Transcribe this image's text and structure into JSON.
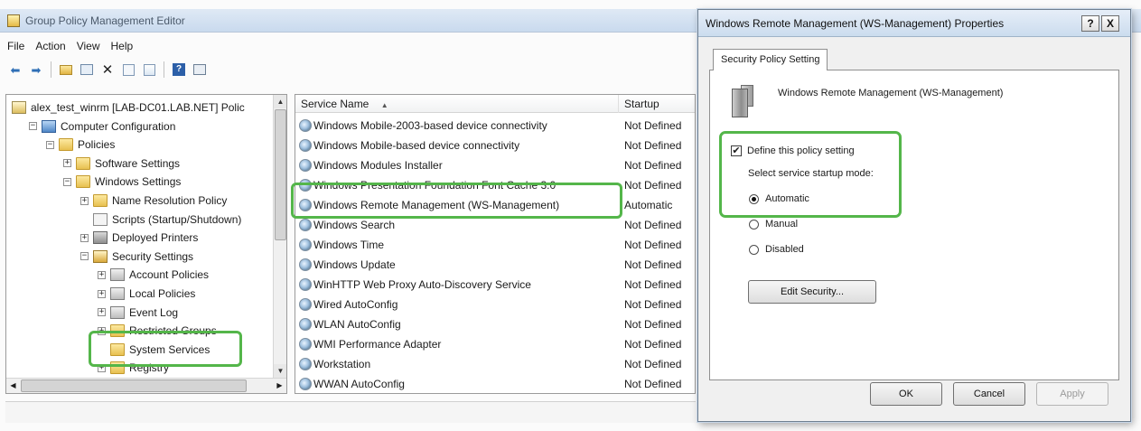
{
  "main_window": {
    "title": "Group Policy Management Editor",
    "menu": [
      "File",
      "Action",
      "View",
      "Help"
    ],
    "toolbar_icons": [
      "back-arrow-icon",
      "forward-arrow-icon",
      "up-folder-icon",
      "show-hide-tree-icon",
      "delete-icon",
      "properties-icon",
      "export-icon",
      "help-icon",
      "console-icon"
    ]
  },
  "tree": {
    "items": [
      {
        "label": "alex_test_winrm [LAB-DC01.LAB.NET] Polic",
        "icon": "gpo-icon",
        "indent": 0,
        "expander": ""
      },
      {
        "label": "Computer Configuration",
        "icon": "computer-icon",
        "indent": 1,
        "expander": "−"
      },
      {
        "label": "Policies",
        "icon": "folder-icon",
        "indent": 2,
        "expander": "−"
      },
      {
        "label": "Software Settings",
        "icon": "folder-icon",
        "indent": 3,
        "expander": "+"
      },
      {
        "label": "Windows Settings",
        "icon": "folder-icon",
        "indent": 3,
        "expander": "−"
      },
      {
        "label": "Name Resolution Policy",
        "icon": "folder-icon",
        "indent": 4,
        "expander": "+"
      },
      {
        "label": "Scripts (Startup/Shutdown)",
        "icon": "document-icon",
        "indent": 4,
        "expander": ""
      },
      {
        "label": "Deployed Printers",
        "icon": "printer-icon",
        "indent": 4,
        "expander": "+"
      },
      {
        "label": "Security Settings",
        "icon": "security-icon",
        "indent": 4,
        "expander": "−"
      },
      {
        "label": "Account Policies",
        "icon": "policy-icon",
        "indent": 5,
        "expander": "+"
      },
      {
        "label": "Local Policies",
        "icon": "policy-icon",
        "indent": 5,
        "expander": "+"
      },
      {
        "label": "Event Log",
        "icon": "policy-icon",
        "indent": 5,
        "expander": "+"
      },
      {
        "label": "Restricted Groups",
        "icon": "folder-icon",
        "indent": 5,
        "expander": "+"
      },
      {
        "label": "System Services",
        "icon": "folder-icon",
        "indent": 5,
        "expander": ""
      },
      {
        "label": "Registry",
        "icon": "folder-icon",
        "indent": 5,
        "expander": "+"
      }
    ]
  },
  "list": {
    "columns": [
      "Service Name",
      "Startup"
    ],
    "sort_indicator": "▲",
    "rows": [
      {
        "name": "Windows Mobile-2003-based device connectivity",
        "startup": "Not Defined"
      },
      {
        "name": "Windows Mobile-based device connectivity",
        "startup": "Not Defined"
      },
      {
        "name": "Windows Modules Installer",
        "startup": "Not Defined"
      },
      {
        "name": "Windows Presentation Foundation Font Cache 3.0",
        "startup": "Not Defined"
      },
      {
        "name": "Windows Remote Management (WS-Management)",
        "startup": "Automatic"
      },
      {
        "name": "Windows Search",
        "startup": "Not Defined"
      },
      {
        "name": "Windows Time",
        "startup": "Not Defined"
      },
      {
        "name": "Windows Update",
        "startup": "Not Defined"
      },
      {
        "name": "WinHTTP Web Proxy Auto-Discovery Service",
        "startup": "Not Defined"
      },
      {
        "name": "Wired AutoConfig",
        "startup": "Not Defined"
      },
      {
        "name": "WLAN AutoConfig",
        "startup": "Not Defined"
      },
      {
        "name": "WMI Performance Adapter",
        "startup": "Not Defined"
      },
      {
        "name": "Workstation",
        "startup": "Not Defined"
      },
      {
        "name": "WWAN AutoConfig",
        "startup": "Not Defined"
      }
    ]
  },
  "dialog": {
    "title": "Windows Remote Management (WS-Management) Properties",
    "help_button": "?",
    "close_button": "X",
    "tab": "Security Policy Setting",
    "service_name": "Windows Remote Management (WS-Management)",
    "define_checkbox": {
      "label": "Define this policy setting",
      "checked": true,
      "mark": "✔"
    },
    "startup_mode_label": "Select service startup mode:",
    "radios": [
      {
        "label": "Automatic",
        "selected": true
      },
      {
        "label": "Manual",
        "selected": false
      },
      {
        "label": "Disabled",
        "selected": false
      }
    ],
    "edit_security_button": "Edit Security...",
    "ok_button": "OK",
    "cancel_button": "Cancel",
    "apply_button": "Apply"
  },
  "colors": {
    "highlight": "#54b64a"
  }
}
